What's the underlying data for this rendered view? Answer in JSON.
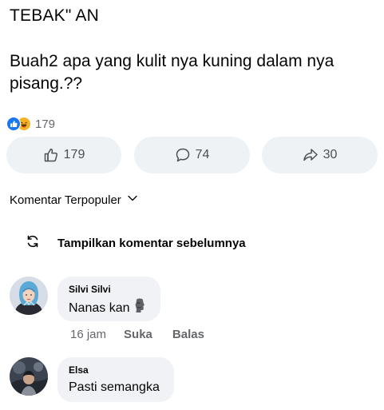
{
  "post": {
    "title": "TEBAK\" AN",
    "body": "Buah2 apa yang kulit nya kuning dalam nya pisang.??",
    "reaction_icons": [
      "like-icon",
      "haha-icon"
    ],
    "reaction_count": "179"
  },
  "actions": {
    "like": {
      "icon": "thumbs-up-icon",
      "count": "179"
    },
    "comment": {
      "icon": "comment-icon",
      "count": "74"
    },
    "share": {
      "icon": "share-icon",
      "count": "30"
    }
  },
  "comments_sort": {
    "label": "Komentar Terpopuler",
    "icon": "chevron-down-icon"
  },
  "show_previous": {
    "label": "Tampilkan komentar sebelumnya",
    "icon": "refresh-icon"
  },
  "comments": [
    {
      "author": "Silvi Silvi",
      "text": "Nanas kan",
      "emoji_icon": "moai-icon",
      "time": "16 jam",
      "like_label": "Suka",
      "reply_label": "Balas"
    },
    {
      "author": "Elsa",
      "text": "Pasti semangka"
    }
  ],
  "colors": {
    "accent": "#1877f2",
    "bubble": "#f0f2f5",
    "button_bg": "#eff2f5",
    "secondary_text": "#65676b"
  }
}
